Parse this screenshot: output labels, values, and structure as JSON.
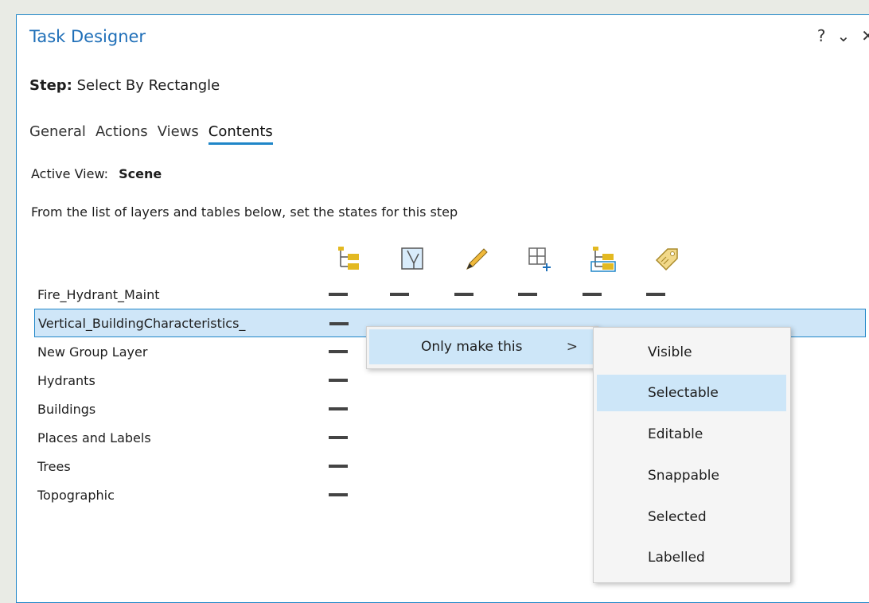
{
  "pane": {
    "title": "Task Designer",
    "help_label": "?",
    "dropdown_label": "⌄",
    "close_label": "✕"
  },
  "step": {
    "label": "Step:",
    "value": "Select By Rectangle"
  },
  "tabs": [
    "General",
    "Actions",
    "Views",
    "Contents"
  ],
  "active_tab": "Contents",
  "active_view": {
    "label": "Active View:",
    "value": "Scene"
  },
  "instructions": "From the list of layers and tables below, set the states for this step",
  "columns": [
    "visible-icon",
    "selectable-icon",
    "editable-icon",
    "snappable-icon",
    "selected-icon",
    "labelled-icon"
  ],
  "layers": [
    "Fire_Hydrant_Maint",
    "Vertical_BuildingCharacteristics_",
    "New Group Layer",
    "Hydrants",
    "Buildings",
    "Places and Labels",
    "Trees",
    "Topographic"
  ],
  "context_menu": {
    "label": "Only make this",
    "arrow": ">"
  },
  "submenu": [
    "Visible",
    "Selectable",
    "Editable",
    "Snappable",
    "Selected",
    "Labelled"
  ],
  "submenu_highlight": "Selectable",
  "colors": {
    "accent": "#1f86c8",
    "highlight": "#cde6f8",
    "title": "#1f6fb8"
  }
}
